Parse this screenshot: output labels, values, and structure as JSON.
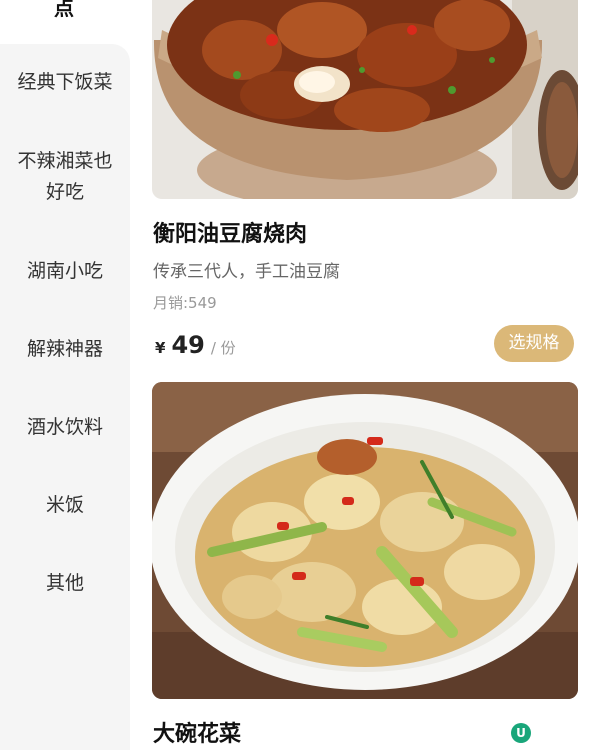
{
  "sidebar": {
    "top_label": "点",
    "categories": [
      {
        "label": "经典下饭菜"
      },
      {
        "label": "不辣湘菜也好吃"
      },
      {
        "label": "湖南小吃"
      },
      {
        "label": "解辣神器"
      },
      {
        "label": "酒水饮料"
      },
      {
        "label": "米饭"
      },
      {
        "label": "其他"
      }
    ]
  },
  "dishes": [
    {
      "name": "衡阳油豆腐烧肉",
      "description": "传承三代人，手工油豆腐",
      "sales": "月销:549",
      "currency": "¥",
      "price": "49",
      "unit": "/ 份",
      "spec_button": "选规格"
    },
    {
      "name": "大碗花菜",
      "badge_icon": "u-badge-icon"
    }
  ],
  "colors": {
    "sidebar_bg": "#f5f5f5",
    "spec_button_bg": "#dbb878",
    "badge_green": "#19a67a"
  }
}
